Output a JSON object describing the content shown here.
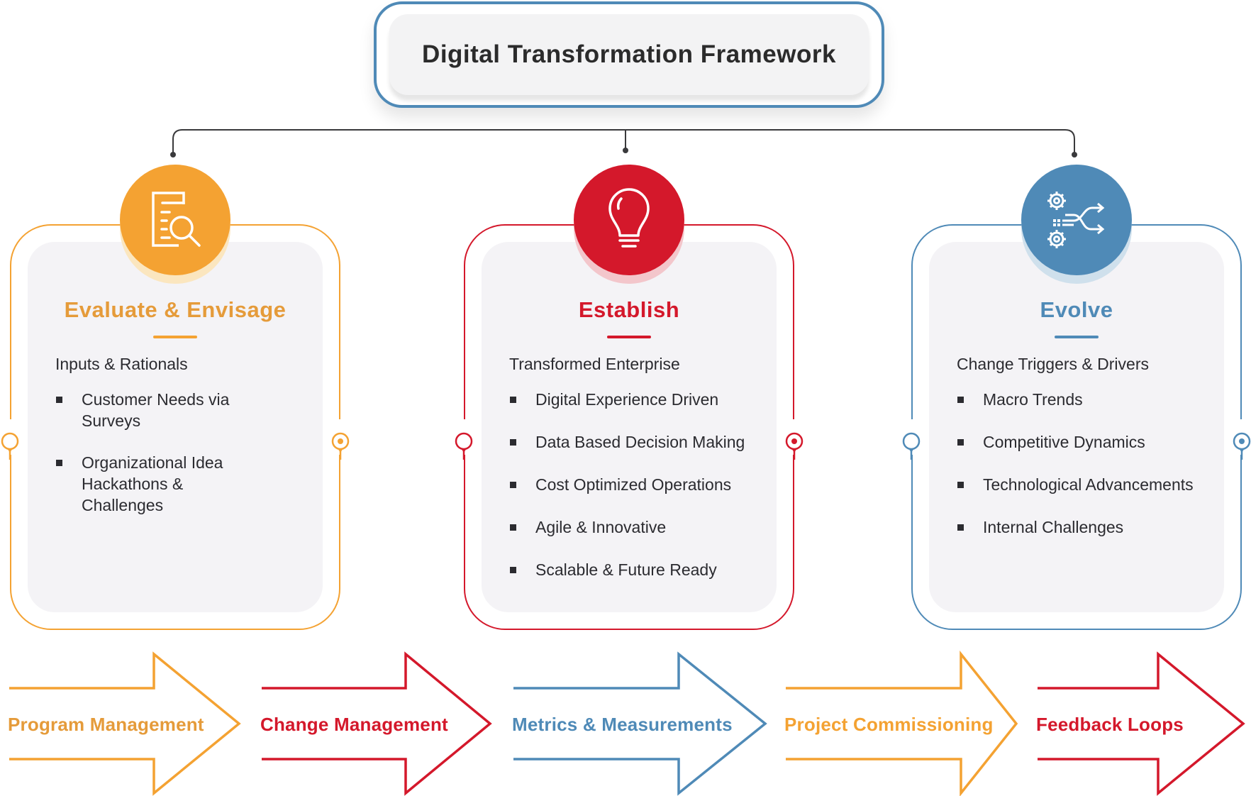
{
  "header": {
    "title": "Digital Transformation Framework"
  },
  "colors": {
    "orange": "#f4a232",
    "red": "#d4182b",
    "blue": "#4f8ab7",
    "connector": "#3a3a3c"
  },
  "pillars": [
    {
      "title": "Evaluate & Envisage",
      "icon": "document-search-icon",
      "color": "orange",
      "subhead": "Inputs & Rationals",
      "items": [
        "Customer Needs via Surveys",
        "Organizational Idea Hackathons & Challenges"
      ]
    },
    {
      "title": "Establish",
      "icon": "lightbulb-icon",
      "color": "red",
      "subhead": "Transformed Enterprise",
      "items": [
        "Digital Experience Driven",
        "Data Based Decision Making",
        "Cost Optimized Operations",
        "Agile & Innovative",
        "Scalable & Future Ready"
      ]
    },
    {
      "title": "Evolve",
      "icon": "gears-shuffle-icon",
      "color": "blue",
      "subhead": "Change Triggers & Drivers",
      "items": [
        "Macro Trends",
        "Competitive Dynamics",
        "Technological Advancements",
        "Internal Challenges"
      ]
    }
  ],
  "flow": [
    {
      "label": "Program Management",
      "color": "orange"
    },
    {
      "label": "Change Management",
      "color": "red"
    },
    {
      "label": "Metrics & Measurements",
      "color": "blue"
    },
    {
      "label": "Project Commissioning",
      "color": "orange"
    },
    {
      "label": "Feedback Loops",
      "color": "red"
    }
  ]
}
